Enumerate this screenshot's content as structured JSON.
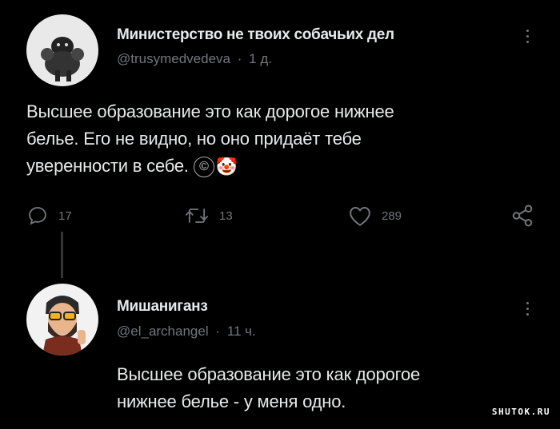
{
  "tweet1": {
    "author_name": "Министерство не твоих собачьих дел",
    "handle": "@trusymedvedeva",
    "separator": "·",
    "time": "1 д.",
    "text_line1": "Высшее образование это как дорогое нижнее",
    "text_line2": "белье. Его не видно, но оно придаёт тебе",
    "text_line3": "уверенности в себе.",
    "copyright": "©",
    "emoji": "🤡",
    "stats": {
      "replies": "17",
      "retweets": "13",
      "likes": "289"
    }
  },
  "tweet2": {
    "author_name": "Мишаниганз",
    "handle": "@el_archangel",
    "separator": "·",
    "time": "11 ч.",
    "text_line1": "Высшее образование это как дорогое",
    "text_line2": "нижнее белье - у меня одно."
  },
  "watermark": "SHUTOK.RU",
  "icons": {
    "reply": "reply-icon",
    "retweet": "retweet-icon",
    "like": "heart-icon",
    "share": "share-icon",
    "more": "more-vertical-icon"
  },
  "colors": {
    "background": "#000000",
    "text": "#e7e9ea",
    "muted": "#71767b"
  }
}
